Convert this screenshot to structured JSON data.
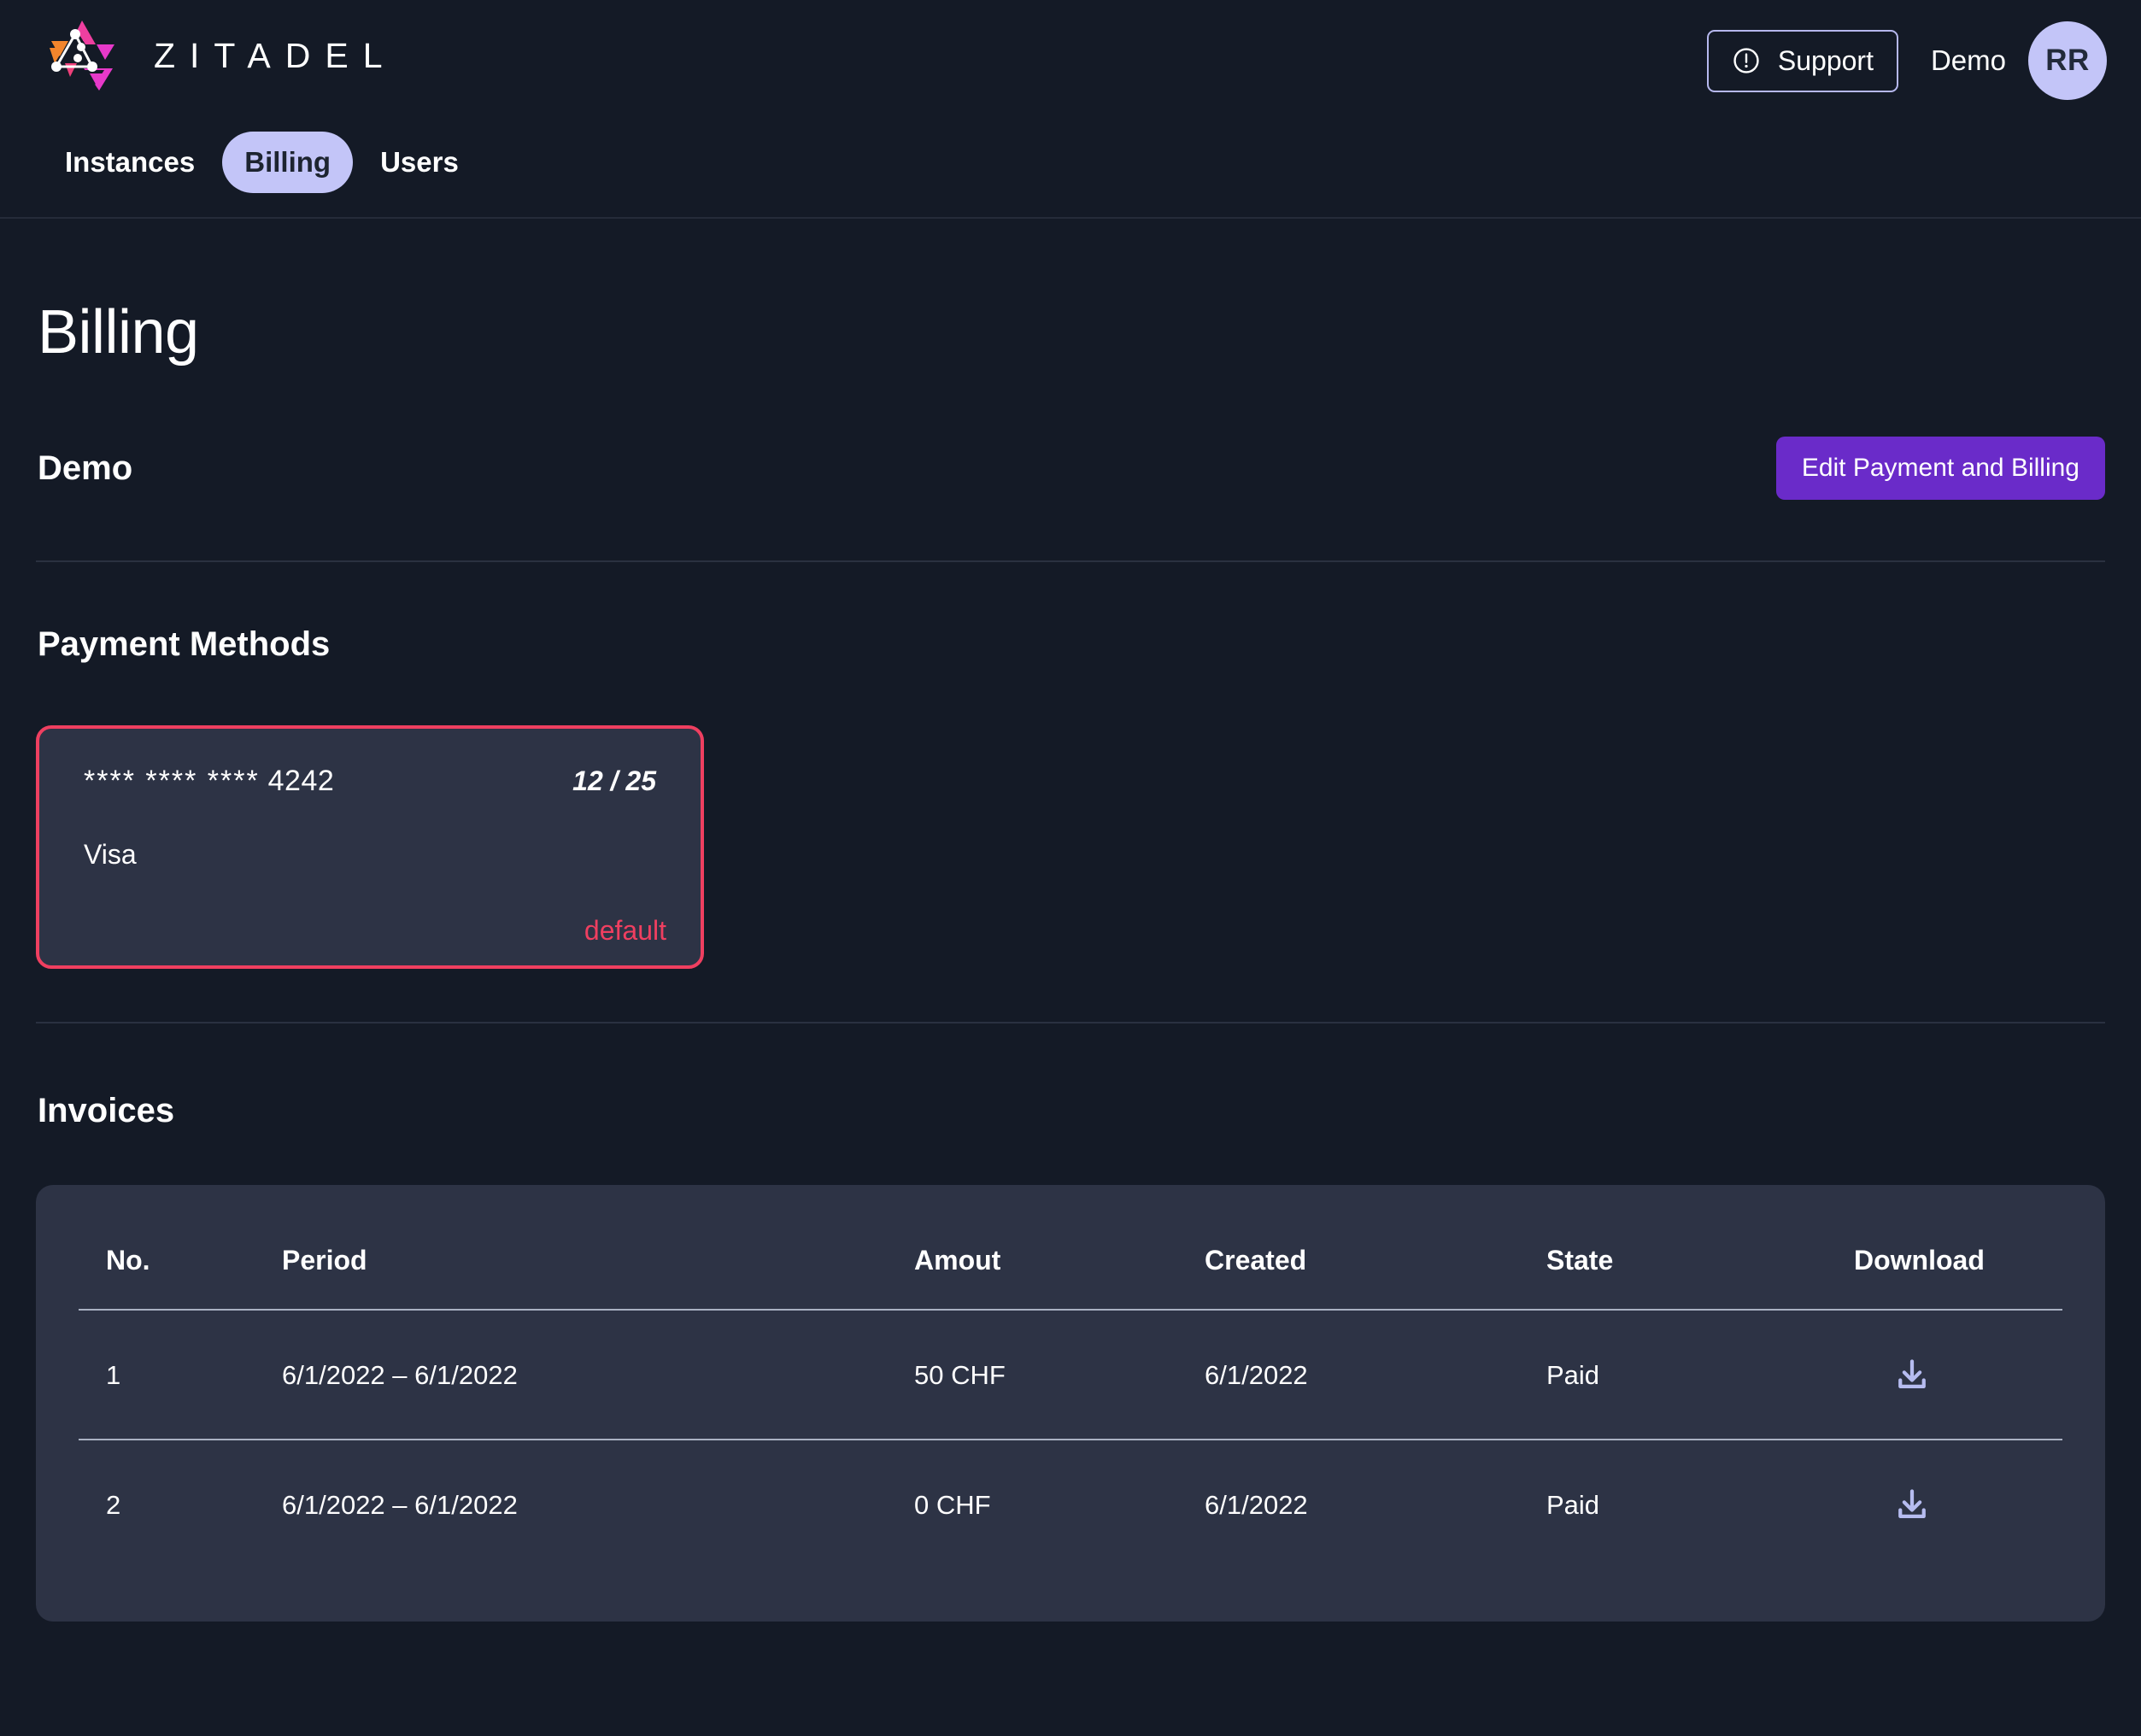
{
  "brand": {
    "name": "ZITADEL",
    "logo_icon": "zitadel-triangle-logo",
    "accent_purple": "#6a2bc9",
    "accent_lavender": "#c3c5f8",
    "accent_pink": "#ef3f60",
    "page_bg": "#141a26",
    "card_bg": "#2d3345"
  },
  "header": {
    "support_label": "Support",
    "support_icon": "exclamation-circle-icon",
    "account_name": "Demo",
    "avatar_initials": "RR"
  },
  "nav": {
    "tabs": [
      {
        "label": "Instances",
        "active": false
      },
      {
        "label": "Billing",
        "active": true
      },
      {
        "label": "Users",
        "active": false
      }
    ]
  },
  "main": {
    "page_title": "Billing",
    "org_name": "Demo",
    "edit_button_label": "Edit Payment and Billing",
    "payment_methods": {
      "section_title": "Payment Methods",
      "cards": [
        {
          "masked_digits": "**** **** ****",
          "last4": "4242",
          "expiry": "12 / 25",
          "brand": "Visa",
          "default_label": "default",
          "is_default": true
        }
      ]
    },
    "invoices": {
      "section_title": "Invoices",
      "columns": [
        "No.",
        "Period",
        "Amout",
        "Created",
        "State",
        "Download"
      ],
      "rows": [
        {
          "no": "1",
          "period": "6/1/2022 – 6/1/2022",
          "amount": "50 CHF",
          "created": "6/1/2022",
          "state": "Paid",
          "download_icon": "download-icon"
        },
        {
          "no": "2",
          "period": "6/1/2022 – 6/1/2022",
          "amount": "0 CHF",
          "created": "6/1/2022",
          "state": "Paid",
          "download_icon": "download-icon"
        }
      ]
    }
  }
}
